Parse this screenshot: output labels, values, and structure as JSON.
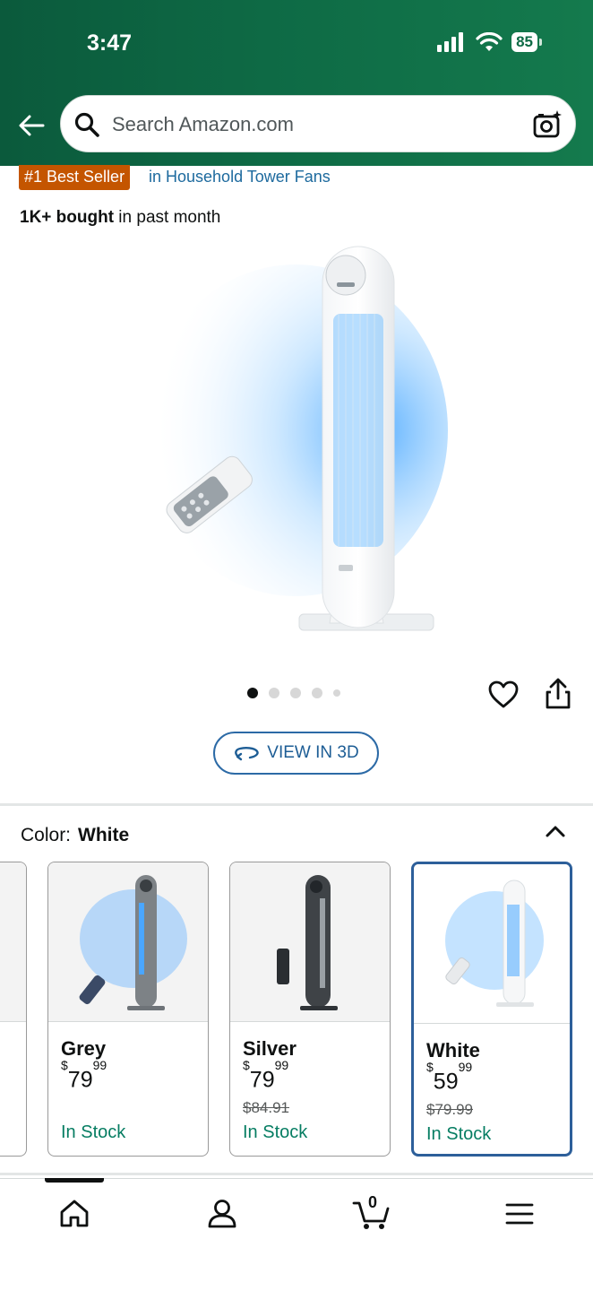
{
  "status_bar": {
    "time": "3:47",
    "battery": "85"
  },
  "search": {
    "placeholder": "Search Amazon.com"
  },
  "product": {
    "badge": "#1 Best Seller",
    "badge_category": "in Household Tower Fans",
    "bought_bold": "1K+ bought",
    "bought_rest": " in past month",
    "carousel_pages": 5,
    "carousel_active": 1,
    "view_3d_label": "VIEW IN 3D"
  },
  "color_selector": {
    "label": "Color:",
    "selected": "White",
    "options": [
      {
        "name": "Grey",
        "price_dollars": "79",
        "price_cents": "99",
        "list_price": "",
        "stock": "In Stock",
        "selected": false
      },
      {
        "name": "Silver",
        "price_dollars": "79",
        "price_cents": "99",
        "list_price": "$84.91",
        "stock": "In Stock",
        "selected": false
      },
      {
        "name": "White",
        "price_dollars": "59",
        "price_cents": "99",
        "list_price": "$79.99",
        "stock": "In Stock",
        "selected": true
      }
    ],
    "currency_symbol": "$"
  },
  "bottom_nav": {
    "items": [
      "home-icon",
      "account-icon",
      "cart-icon",
      "menu-icon"
    ],
    "cart_count": "0"
  },
  "colors": {
    "header_green": "#0e6a45",
    "badge_orange": "#c45500",
    "link_blue": "#1d6a9e",
    "stock_green": "#067d62",
    "selected_border": "#2d5f9a"
  }
}
